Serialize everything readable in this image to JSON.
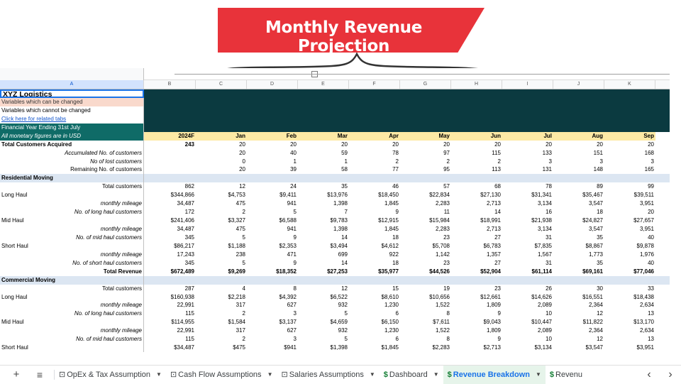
{
  "banner": {
    "title": "Monthly Revenue Projection"
  },
  "colors": {
    "banner": "#e8333a",
    "header_dark": "#0b3a40",
    "teal": "#0f6b67",
    "year_bg": "#fde9a5",
    "section_bg": "#dce6f2",
    "peach": "#f9d9cc",
    "active_tab": "#1a73e8"
  },
  "sheet": {
    "columns": [
      "A",
      "B",
      "C",
      "D",
      "E",
      "F",
      "G",
      "H",
      "I",
      "J",
      "K"
    ],
    "selected_column": "A",
    "info": {
      "company": "XYZ Logistics",
      "changeable": "Variables which can be changed",
      "unchangeable": "Variables which cannot be changed",
      "link": "Click here for related tabs",
      "fy": "Financial Year Ending 31st July",
      "currency": "All monetary figures are in USD"
    },
    "periods": [
      "2024F",
      "Jan",
      "Feb",
      "Mar",
      "Apr",
      "May",
      "Jun",
      "Jul",
      "Aug",
      "Sep"
    ],
    "rows": [
      {
        "label": "Total Customers Acquired",
        "style": "bold-left",
        "values": [
          "243",
          "20",
          "20",
          "20",
          "20",
          "20",
          "20",
          "20",
          "20",
          "20"
        ]
      },
      {
        "label": "Accumulated No. of customers",
        "style": "italic-right",
        "values": [
          "",
          "20",
          "40",
          "59",
          "78",
          "97",
          "115",
          "133",
          "151",
          "168"
        ]
      },
      {
        "label": "No of lost customers",
        "style": "italic-right",
        "values": [
          "",
          "0",
          "1",
          "1",
          "2",
          "2",
          "2",
          "3",
          "3",
          "3"
        ]
      },
      {
        "label": "Remaining No. of customers",
        "style": "right",
        "values": [
          "",
          "20",
          "39",
          "58",
          "77",
          "95",
          "113",
          "131",
          "148",
          "165"
        ]
      },
      {
        "label": "Residential Moving",
        "style": "section",
        "values": [
          "",
          "",
          "",
          "",
          "",
          "",
          "",
          "",
          "",
          ""
        ]
      },
      {
        "label": "Total customers",
        "style": "right",
        "values": [
          "862",
          "12",
          "24",
          "35",
          "46",
          "57",
          "68",
          "78",
          "89",
          "99"
        ]
      },
      {
        "label": "Long Haul",
        "style": "left",
        "values": [
          "$344,866",
          "$4,753",
          "$9,411",
          "$13,976",
          "$18,450",
          "$22,834",
          "$27,130",
          "$31,341",
          "$35,467",
          "$39,511"
        ]
      },
      {
        "label": "monthly mileage",
        "style": "italic-right",
        "values": [
          "34,487",
          "475",
          "941",
          "1,398",
          "1,845",
          "2,283",
          "2,713",
          "3,134",
          "3,547",
          "3,951"
        ]
      },
      {
        "label": "No. of long haul customers",
        "style": "italic-right",
        "values": [
          "172",
          "2",
          "5",
          "7",
          "9",
          "11",
          "14",
          "16",
          "18",
          "20"
        ]
      },
      {
        "label": "Mid Haul",
        "style": "left",
        "values": [
          "$241,406",
          "$3,327",
          "$6,588",
          "$9,783",
          "$12,915",
          "$15,984",
          "$18,991",
          "$21,938",
          "$24,827",
          "$27,657"
        ]
      },
      {
        "label": "monthly mileage",
        "style": "italic-right",
        "values": [
          "34,487",
          "475",
          "941",
          "1,398",
          "1,845",
          "2,283",
          "2,713",
          "3,134",
          "3,547",
          "3,951"
        ]
      },
      {
        "label": "No. of mid haul customers",
        "style": "italic-right",
        "values": [
          "345",
          "5",
          "9",
          "14",
          "18",
          "23",
          "27",
          "31",
          "35",
          "40"
        ]
      },
      {
        "label": "Short Haul",
        "style": "left",
        "values": [
          "$86,217",
          "$1,188",
          "$2,353",
          "$3,494",
          "$4,612",
          "$5,708",
          "$6,783",
          "$7,835",
          "$8,867",
          "$9,878"
        ]
      },
      {
        "label": "monthly mileage",
        "style": "italic-right",
        "values": [
          "17,243",
          "238",
          "471",
          "699",
          "922",
          "1,142",
          "1,357",
          "1,567",
          "1,773",
          "1,976"
        ]
      },
      {
        "label": "No. of short haul customers",
        "style": "italic-right",
        "values": [
          "345",
          "5",
          "9",
          "14",
          "18",
          "23",
          "27",
          "31",
          "35",
          "40"
        ]
      },
      {
        "label": "Total Revenue",
        "style": "bold-right",
        "values": [
          "$672,489",
          "$9,269",
          "$18,352",
          "$27,253",
          "$35,977",
          "$44,526",
          "$52,904",
          "$61,114",
          "$69,161",
          "$77,046"
        ]
      },
      {
        "label": "Commercial Moving",
        "style": "section",
        "values": [
          "",
          "",
          "",
          "",
          "",
          "",
          "",
          "",
          "",
          ""
        ]
      },
      {
        "label": "Total customers",
        "style": "right",
        "values": [
          "287",
          "4",
          "8",
          "12",
          "15",
          "19",
          "23",
          "26",
          "30",
          "33"
        ]
      },
      {
        "label": "Long Haul",
        "style": "left",
        "values": [
          "$160,938",
          "$2,218",
          "$4,392",
          "$6,522",
          "$8,610",
          "$10,656",
          "$12,661",
          "$14,626",
          "$16,551",
          "$18,438"
        ]
      },
      {
        "label": "monthly mileage",
        "style": "italic-right",
        "values": [
          "22,991",
          "317",
          "627",
          "932",
          "1,230",
          "1,522",
          "1,809",
          "2,089",
          "2,364",
          "2,634"
        ]
      },
      {
        "label": "No. of long haul customers",
        "style": "italic-right",
        "values": [
          "115",
          "2",
          "3",
          "5",
          "6",
          "8",
          "9",
          "10",
          "12",
          "13"
        ]
      },
      {
        "label": "Mid Haul",
        "style": "left",
        "values": [
          "$114,955",
          "$1,584",
          "$3,137",
          "$4,659",
          "$6,150",
          "$7,611",
          "$9,043",
          "$10,447",
          "$11,822",
          "$13,170"
        ]
      },
      {
        "label": "monthly mileage",
        "style": "italic-right",
        "values": [
          "22,991",
          "317",
          "627",
          "932",
          "1,230",
          "1,522",
          "1,809",
          "2,089",
          "2,364",
          "2,634"
        ]
      },
      {
        "label": "No. of mid haul customers",
        "style": "italic-right",
        "values": [
          "115",
          "2",
          "3",
          "5",
          "6",
          "8",
          "9",
          "10",
          "12",
          "13"
        ]
      },
      {
        "label": "Short Haul",
        "style": "left",
        "values": [
          "$34,487",
          "$475",
          "$941",
          "$1,398",
          "$1,845",
          "$2,283",
          "$2,713",
          "$3,134",
          "$3,547",
          "$3,951"
        ]
      }
    ]
  },
  "tabbar": {
    "add_icon": "+",
    "menu_icon": "≡",
    "tabs": [
      {
        "label": "OpEx & Tax Assumption",
        "icon": "sheet-icon",
        "glyph": "⊡",
        "active": false
      },
      {
        "label": "Cash Flow Assumptions",
        "icon": "sheet-icon",
        "glyph": "⊡",
        "active": false
      },
      {
        "label": "Salaries Assumptions",
        "icon": "sheet-icon",
        "glyph": "⊡",
        "active": false
      },
      {
        "label": "Dashboard",
        "icon": "dollar-icon",
        "glyph": "$",
        "active": false
      },
      {
        "label": "Revenue Breakdown",
        "icon": "dollar-icon",
        "glyph": "$",
        "active": true
      },
      {
        "label": "Revenu",
        "icon": "dollar-icon",
        "glyph": "$",
        "active": false
      }
    ],
    "dropdown_glyph": "▼",
    "prev_glyph": "‹",
    "next_glyph": "›"
  }
}
